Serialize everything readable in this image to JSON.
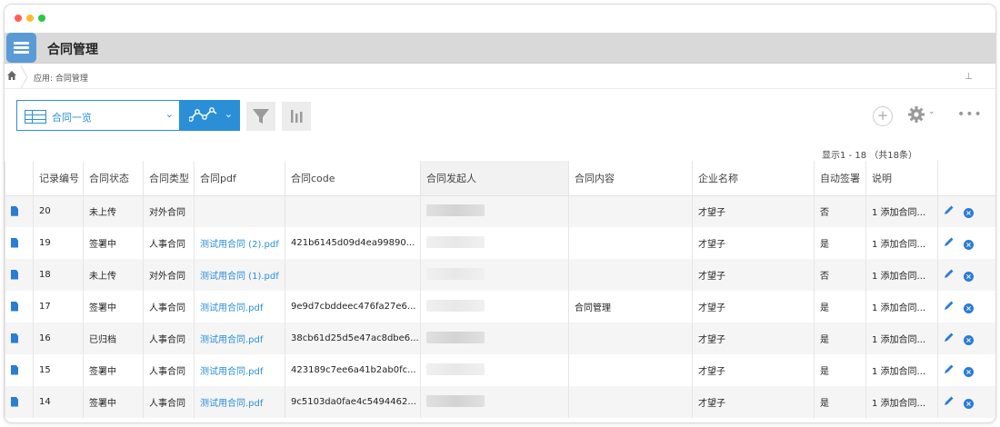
{
  "colors": {
    "accent": "#2b8fd8",
    "window_red": "#ff5f57",
    "window_yellow": "#febc2e",
    "window_green": "#28c840",
    "header_bg": "#d9d9d9"
  },
  "app": {
    "title": "合同管理",
    "icon": "list-icon"
  },
  "breadcrumb": {
    "home_icon": "home-icon",
    "path": "应用: 合同管理",
    "pin_icon": "pin-icon",
    "pin": "⊥"
  },
  "toolbar": {
    "view_label": "合同一览",
    "view_chevron": "⌄",
    "chart_chevron": "⌄",
    "filter_icon": "filter-icon",
    "bar_chart_icon": "bar-chart-icon",
    "add": "+",
    "settings_icon": "gear-icon",
    "settings_chevron": "⌄",
    "more": "•••"
  },
  "pagination": {
    "text": "显示1 - 18 （共18条）"
  },
  "table": {
    "columns": [
      "",
      "记录编号",
      "合同状态",
      "合同类型",
      "合同pdf",
      "合同code",
      "合同发起人",
      "合同内容",
      "企业名称",
      "自动签署",
      "说明",
      ""
    ],
    "rows": [
      {
        "id": "20",
        "status": "未上传",
        "type": "对外合同",
        "pdf": "",
        "code": "",
        "content": "",
        "company": "才望子",
        "auto": "否",
        "note": "1 添加合同..."
      },
      {
        "id": "19",
        "status": "签署中",
        "type": "人事合同",
        "pdf": "测试用合同 (2).pdf",
        "code": "421b6145d09d4ea99890...",
        "content": "",
        "company": "才望子",
        "auto": "是",
        "note": "1 添加合同..."
      },
      {
        "id": "18",
        "status": "未上传",
        "type": "对外合同",
        "pdf": "测试用合同 (1).pdf",
        "code": "",
        "content": "",
        "company": "才望子",
        "auto": "否",
        "note": "1 添加合同..."
      },
      {
        "id": "17",
        "status": "签署中",
        "type": "人事合同",
        "pdf": "测试用合同.pdf",
        "code": "9e9d7cbddeec476fa27e6...",
        "content": "合同管理",
        "company": "才望子",
        "auto": "是",
        "note": "1 添加合同..."
      },
      {
        "id": "16",
        "status": "已归档",
        "type": "人事合同",
        "pdf": "测试用合同.pdf",
        "code": "38cb61d25d5e47ac8dbe6...",
        "content": "",
        "company": "才望子",
        "auto": "是",
        "note": "1 添加合同..."
      },
      {
        "id": "15",
        "status": "签署中",
        "type": "人事合同",
        "pdf": "测试用合同.pdf",
        "code": "423189c7ee6a41b2ab0fc...",
        "content": "",
        "company": "才望子",
        "auto": "是",
        "note": "1 添加合同..."
      },
      {
        "id": "14",
        "status": "签署中",
        "type": "人事合同",
        "pdf": "测试用合同.pdf",
        "code": "9c5103da0fae4c5494462...",
        "content": "",
        "company": "才望子",
        "auto": "是",
        "note": "1 添加合同..."
      }
    ]
  }
}
